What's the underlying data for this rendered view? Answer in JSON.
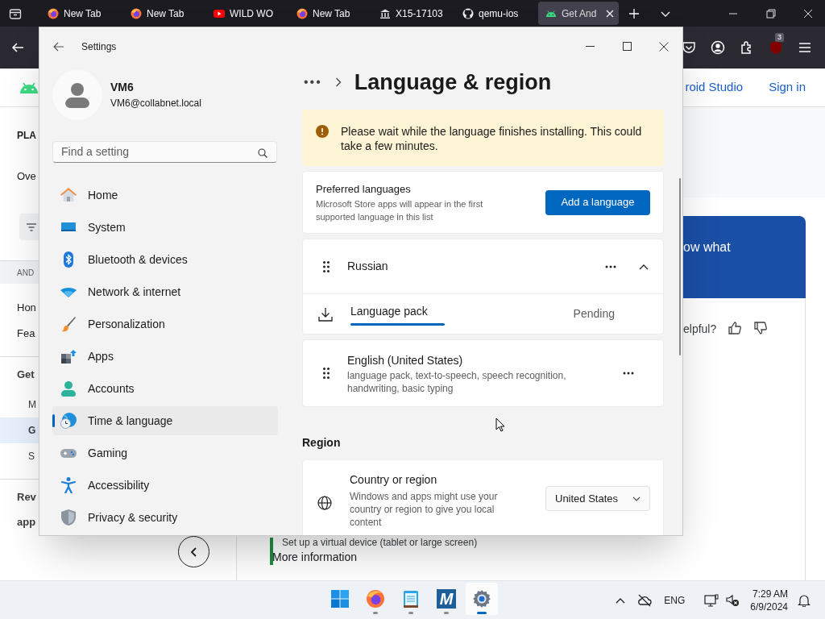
{
  "browser": {
    "tabs": [
      {
        "kind": "firefox",
        "label": "New Tab",
        "selected": false
      },
      {
        "kind": "firefox",
        "label": "New Tab",
        "selected": false
      },
      {
        "kind": "youtube",
        "label": "WILD WO",
        "selected": false
      },
      {
        "kind": "firefox",
        "label": "New Tab",
        "selected": false
      },
      {
        "kind": "museum",
        "label": "X15-17103",
        "selected": false
      },
      {
        "kind": "github",
        "label": "qemu-ios",
        "selected": false
      },
      {
        "kind": "android",
        "label": "Get And",
        "selected": true
      }
    ],
    "extension_badge": "3",
    "page": {
      "header_links": [
        "roid Studio",
        "Sign in"
      ],
      "left_nav": [
        {
          "kind": "title",
          "label": "PLA",
          "selected": false
        },
        {
          "kind": "link",
          "label": "Ove",
          "selected": false
        },
        {
          "kind": "filter",
          "selected": false
        },
        {
          "kind": "section",
          "label": "AND",
          "selected": false
        },
        {
          "kind": "link",
          "label": "Hon",
          "selected": false
        },
        {
          "kind": "link",
          "label": "Fea",
          "selected": false
        },
        {
          "kind": "heading",
          "label": "Get",
          "selected": false
        },
        {
          "kind": "sub",
          "label": "M",
          "selected": false
        },
        {
          "kind": "sub",
          "label": "G",
          "selected": true
        },
        {
          "kind": "sub",
          "label": "S",
          "selected": false
        },
        {
          "kind": "heading",
          "label": "Rev",
          "selected": false
        },
        {
          "kind": "continuation",
          "label": "app",
          "selected": false
        }
      ],
      "banner_text": "ow what",
      "feedback": "elpful?",
      "step_text": "Set up a virtual device (tablet or large screen)",
      "more_link": "More information"
    }
  },
  "settings": {
    "title": "Settings",
    "user": {
      "name": "VM6",
      "email": "VM6@collabnet.local"
    },
    "search": {
      "placeholder": "Find a setting"
    },
    "nav": [
      {
        "kind": "home",
        "label": "Home",
        "selected": false
      },
      {
        "kind": "system",
        "label": "System",
        "selected": false
      },
      {
        "kind": "bluetooth",
        "label": "Bluetooth & devices",
        "selected": false
      },
      {
        "kind": "network",
        "label": "Network & internet",
        "selected": false
      },
      {
        "kind": "personalization",
        "label": "Personalization",
        "selected": false
      },
      {
        "kind": "apps",
        "label": "Apps",
        "selected": false
      },
      {
        "kind": "accounts",
        "label": "Accounts",
        "selected": false
      },
      {
        "kind": "time",
        "label": "Time & language",
        "selected": true
      },
      {
        "kind": "gaming",
        "label": "Gaming",
        "selected": false
      },
      {
        "kind": "accessibility",
        "label": "Accessibility",
        "selected": false
      },
      {
        "kind": "privacy",
        "label": "Privacy & security",
        "selected": false
      }
    ],
    "breadcrumb_more": "•••",
    "page_title": "Language & region",
    "warning": "Please wait while the language finishes installing. This could take a few minutes.",
    "preferred": {
      "title": "Preferred languages",
      "description": "Microsoft Store apps will appear in the first supported language in this list",
      "button": "Add a language"
    },
    "languages": [
      {
        "name": "Russian",
        "expanded": true,
        "features": [
          {
            "label": "Language pack",
            "status": "Pending"
          }
        ]
      },
      {
        "name": "English (United States)",
        "description": "language pack, text-to-speech, speech recognition, handwriting, basic typing",
        "expanded": false
      }
    ],
    "region_heading": "Region",
    "country": {
      "title": "Country or region",
      "description": "Windows and apps might use your country or region to give you local content",
      "value": "United States"
    }
  },
  "taskbar": {
    "apps": [
      {
        "kind": "start",
        "running": false,
        "active": false
      },
      {
        "kind": "firefox",
        "running": true,
        "active": false
      },
      {
        "kind": "notepad",
        "running": true,
        "active": false
      },
      {
        "kind": "m-app",
        "glyph": "M",
        "running": true,
        "active": false
      },
      {
        "kind": "settings",
        "running": true,
        "active": true
      }
    ],
    "language": "ENG",
    "time": "7:29 AM",
    "date": "6/9/2024"
  }
}
